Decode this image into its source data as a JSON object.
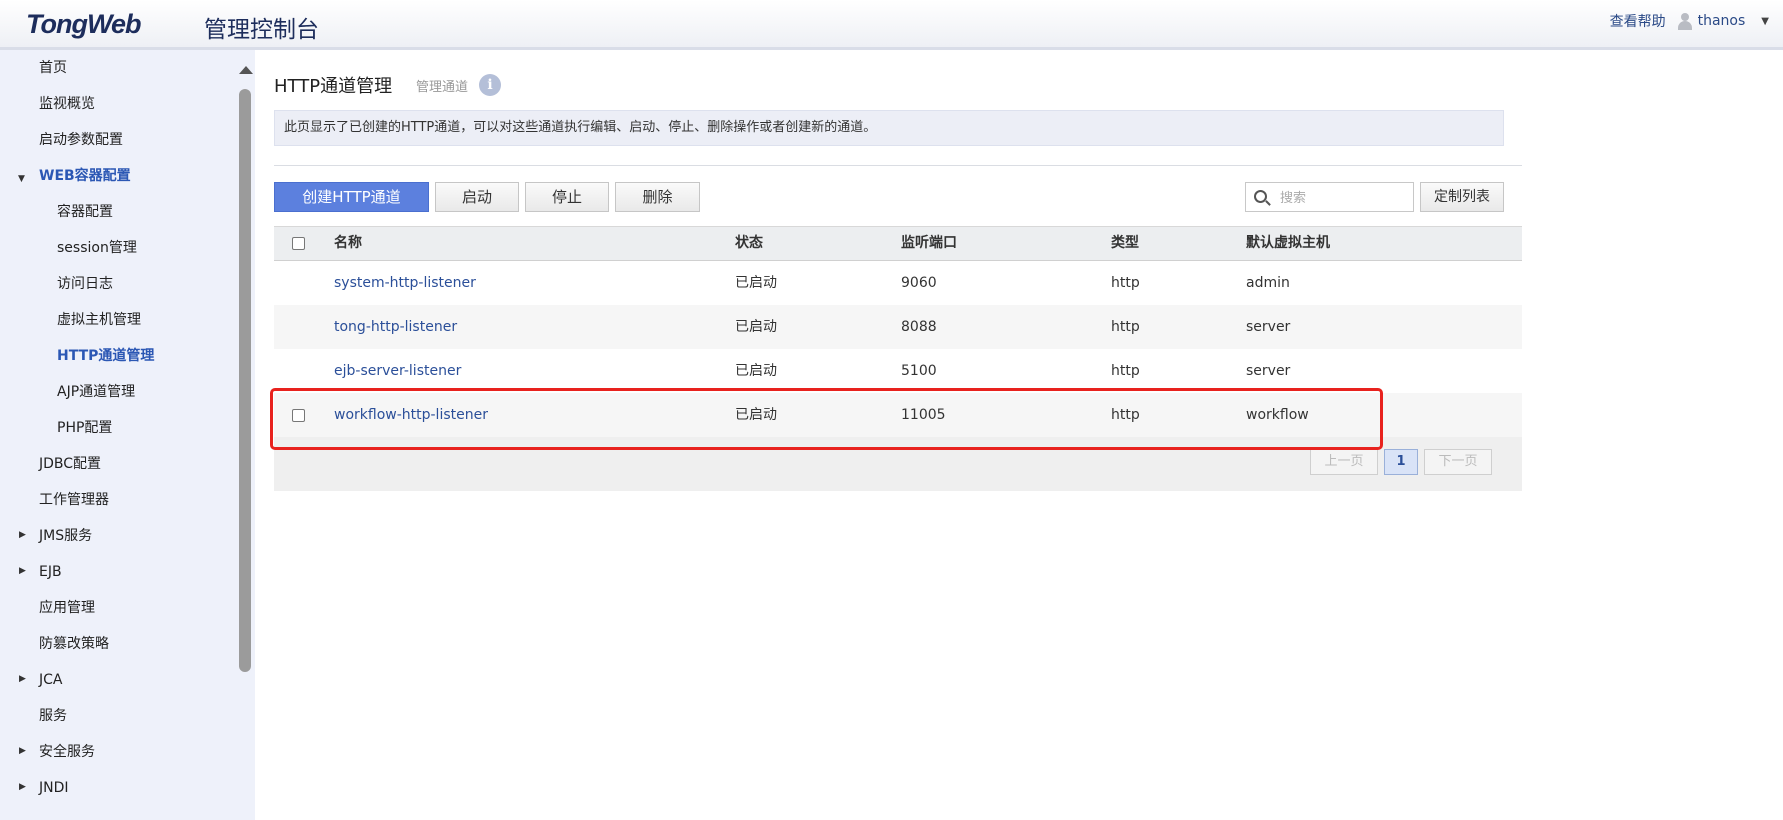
{
  "header": {
    "logo": "TongWeb",
    "subtitle": "管理控制台",
    "help": "查看帮助",
    "username": "thanos"
  },
  "sidebar": {
    "items": [
      {
        "label": "首页"
      },
      {
        "label": "监视概览"
      },
      {
        "label": "启动参数配置"
      },
      {
        "label": "WEB容器配置",
        "expanded": true
      },
      {
        "label": "容器配置"
      },
      {
        "label": "session管理"
      },
      {
        "label": "访问日志"
      },
      {
        "label": "虚拟主机管理"
      },
      {
        "label": "HTTP通道管理",
        "active": true
      },
      {
        "label": "AJP通道管理"
      },
      {
        "label": "PHP配置"
      },
      {
        "label": "JDBC配置"
      },
      {
        "label": "工作管理器"
      },
      {
        "label": "JMS服务",
        "collapsed": true
      },
      {
        "label": "EJB",
        "collapsed": true
      },
      {
        "label": "应用管理"
      },
      {
        "label": "防篡改策略"
      },
      {
        "label": "JCA",
        "collapsed": true
      },
      {
        "label": "服务"
      },
      {
        "label": "安全服务",
        "collapsed": true
      },
      {
        "label": "JNDI",
        "collapsed": true
      }
    ]
  },
  "main": {
    "title": "HTTP通道管理",
    "subtitle": "管理通道",
    "info_icon": "info-icon",
    "description": "此页显示了已创建的HTTP通道，可以对这些通道执行编辑、启动、停止、删除操作或者创建新的通道。",
    "toolbar": {
      "create": "创建HTTP通道",
      "start": "启动",
      "stop": "停止",
      "delete": "删除",
      "search_placeholder": "搜索",
      "customize": "定制列表"
    },
    "table": {
      "headers": {
        "name": "名称",
        "status": "状态",
        "port": "监听端口",
        "type": "类型",
        "vhost": "默认虚拟主机"
      },
      "rows": [
        {
          "name": "system-http-listener",
          "status": "已启动",
          "port": "9060",
          "type": "http",
          "vhost": "admin"
        },
        {
          "name": "tong-http-listener",
          "status": "已启动",
          "port": "8088",
          "type": "http",
          "vhost": "server"
        },
        {
          "name": "ejb-server-listener",
          "status": "已启动",
          "port": "5100",
          "type": "http",
          "vhost": "server"
        },
        {
          "name": "workflow-http-listener",
          "status": "已启动",
          "port": "11005",
          "type": "http",
          "vhost": "workflow"
        }
      ]
    },
    "pagination": {
      "prev": "上一页",
      "current": "1",
      "next": "下一页"
    }
  },
  "colors": {
    "accent": "#5c80de",
    "link": "#2b4f99",
    "highlight": "#e8221e"
  }
}
